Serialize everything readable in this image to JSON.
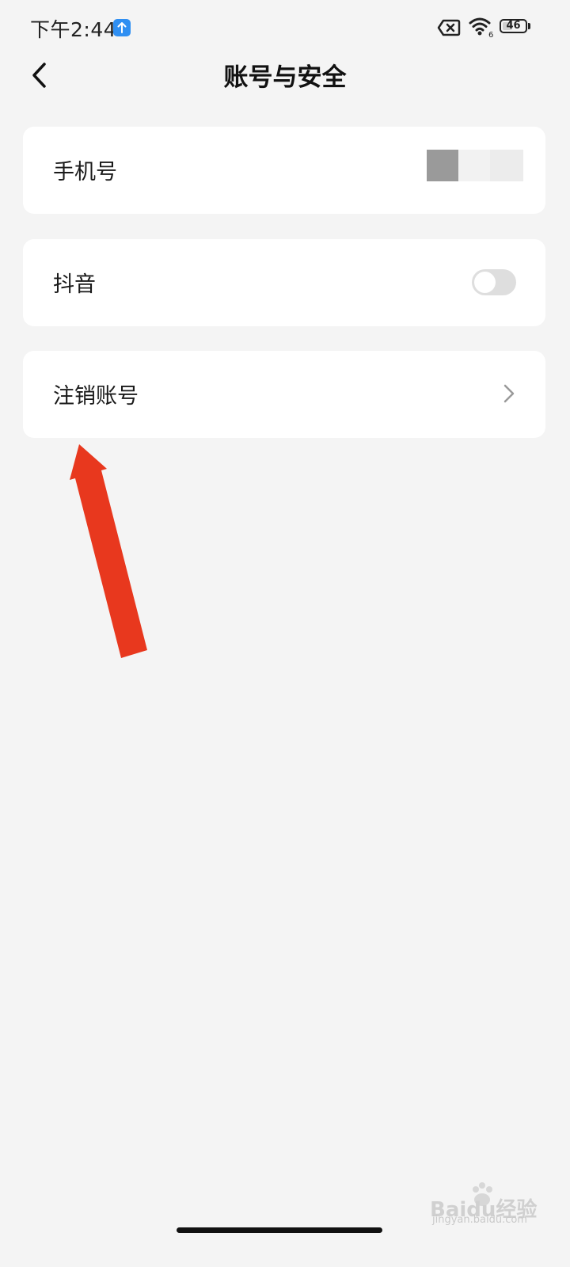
{
  "status_bar": {
    "time": "下午2:44",
    "battery_level": "46",
    "battery_fraction": 0.46,
    "icons": [
      "upload-icon",
      "sim-error-icon",
      "wifi-icon",
      "battery-icon"
    ]
  },
  "header": {
    "title": "账号与安全",
    "back_icon": "chevron-left-icon"
  },
  "settings": [
    {
      "label": "手机号",
      "trailing": "masked-phone-number"
    },
    {
      "label": "抖音",
      "trailing": "toggle",
      "toggle_on": false
    },
    {
      "label": "注销账号",
      "trailing": "chevron-right-icon"
    }
  ],
  "annotation": {
    "type": "arrow",
    "color": "#e8381e",
    "points_to": "注销账号"
  },
  "watermark": {
    "text": "Baidu经验",
    "subtext": "jingyan.baidu.com"
  },
  "colors": {
    "background": "#f4f4f4",
    "card": "#ffffff",
    "toggle_off": "#dedede",
    "accent_upload": "#2f8ff2"
  }
}
